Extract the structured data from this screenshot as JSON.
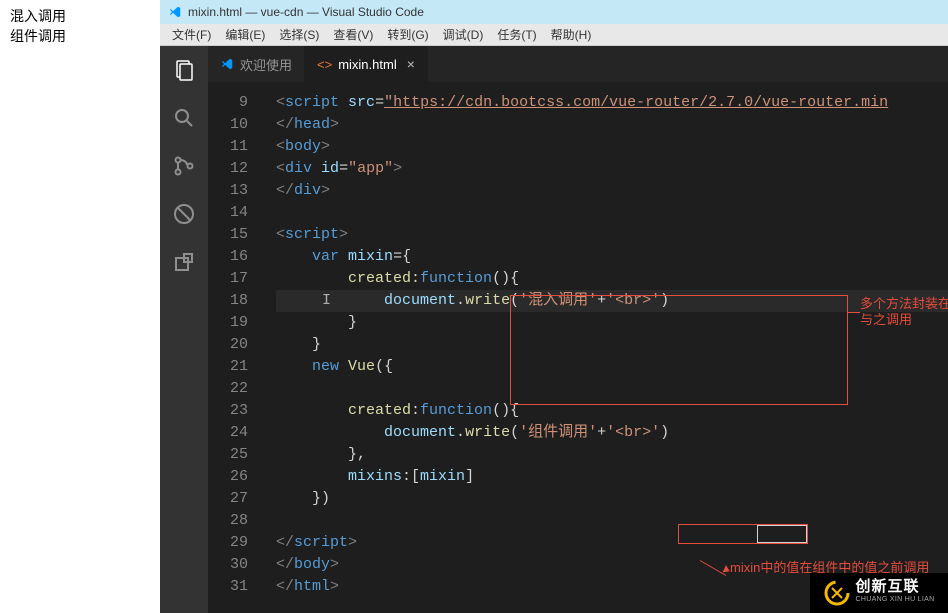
{
  "left_panel": {
    "line1": "混入调用",
    "line2": "组件调用"
  },
  "titlebar": "mixin.html — vue-cdn — Visual Studio Code",
  "menu": {
    "file": "文件(F)",
    "edit": "编辑(E)",
    "select": "选择(S)",
    "view": "查看(V)",
    "goto": "转到(G)",
    "debug": "调试(D)",
    "tasks": "任务(T)",
    "help": "帮助(H)"
  },
  "tabs": {
    "welcome": "欢迎使用",
    "mixin": "mixin.html"
  },
  "line_numbers": [
    "9",
    "10",
    "11",
    "12",
    "13",
    "14",
    "15",
    "16",
    "17",
    "18",
    "19",
    "20",
    "21",
    "22",
    "23",
    "24",
    "25",
    "26",
    "27",
    "28",
    "29",
    "30",
    "31"
  ],
  "code": {
    "l9_url": "https://cdn.bootcss.com/vue-router/2.7.0/vue-router.min",
    "l18_str": "'混入调用'",
    "l18_br": "'<br>'",
    "l24_str": "'组件调用'",
    "l24_br": "'<br>'"
  },
  "annotations": {
    "a1": "多个方法封装在mixin中，组件需要即可与之调用",
    "a2": "mixin中的值在组件中的值之前调用"
  },
  "watermark": {
    "cn": "创新互联",
    "en": "CHUANG XIN HU LIAN"
  }
}
